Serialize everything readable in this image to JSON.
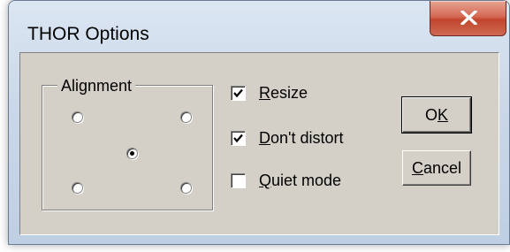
{
  "window": {
    "title": "THOR Options"
  },
  "alignment": {
    "label": "Alignment",
    "options": [
      {
        "id": "top-left",
        "selected": false
      },
      {
        "id": "top-right",
        "selected": false
      },
      {
        "id": "center",
        "selected": true
      },
      {
        "id": "bottom-left",
        "selected": false
      },
      {
        "id": "bottom-right",
        "selected": false
      }
    ]
  },
  "checkboxes": [
    {
      "mnemonic": "R",
      "rest": "esize",
      "checked": true
    },
    {
      "mnemonic": "D",
      "rest": "on't distort",
      "checked": true
    },
    {
      "mnemonic": "Q",
      "rest": "uiet mode",
      "checked": false
    }
  ],
  "buttons": {
    "ok": {
      "before": "O",
      "mnemonic": "K"
    },
    "cancel": {
      "mnemonic": "C",
      "rest": "ancel"
    }
  },
  "icons": {
    "close": "close-icon",
    "check": "checkmark-icon"
  },
  "colors": {
    "close_button": "#c2452d",
    "dialog_face": "#d4d0c8"
  }
}
